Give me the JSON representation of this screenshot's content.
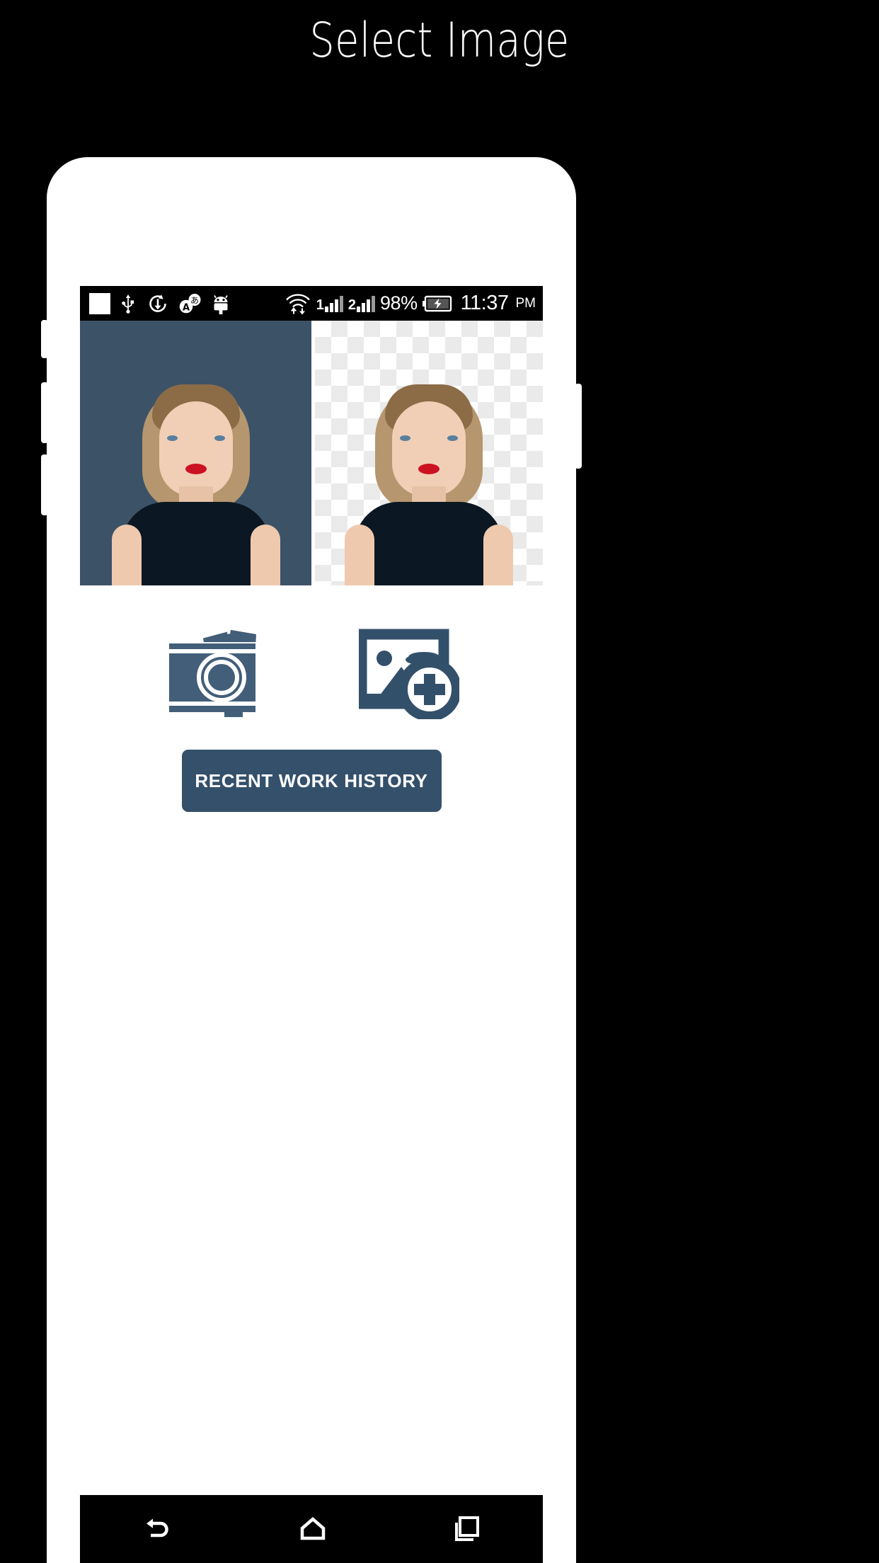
{
  "page": {
    "title": "Select Image",
    "background_color": "#000000",
    "title_color": "#ffffff"
  },
  "phone": {
    "frame_color": "#ffffff"
  },
  "status_bar": {
    "background_color": "#000000",
    "left_icons": [
      "white-square-icon",
      "usb-icon",
      "download-sync-icon",
      "language-input-icon",
      "android-robot-icon"
    ],
    "right_icons": [
      "wifi-transfer-icon",
      "sim1-signal-icon",
      "sim2-signal-icon",
      "battery-charging-icon"
    ],
    "sim1_label": "1",
    "sim2_label": "2",
    "battery_percent": "98%",
    "time": "11:37",
    "meridiem": "PM"
  },
  "preview": {
    "before_background_color": "#3c5267",
    "after_background": "transparency-checkerboard",
    "before_label": "original-photo",
    "after_label": "background-removed-photo"
  },
  "actions": {
    "camera": {
      "name": "camera-icon",
      "color": "#425e78"
    },
    "gallery": {
      "name": "add-image-icon",
      "color": "#33506b"
    },
    "history_button": {
      "label": "RECENT WORK HISTORY",
      "background_color": "#34506b",
      "text_color": "#ffffff"
    }
  },
  "nav_bar": {
    "background_color": "#000000",
    "buttons": [
      {
        "name": "back-icon"
      },
      {
        "name": "home-icon"
      },
      {
        "name": "recents-icon"
      }
    ]
  }
}
